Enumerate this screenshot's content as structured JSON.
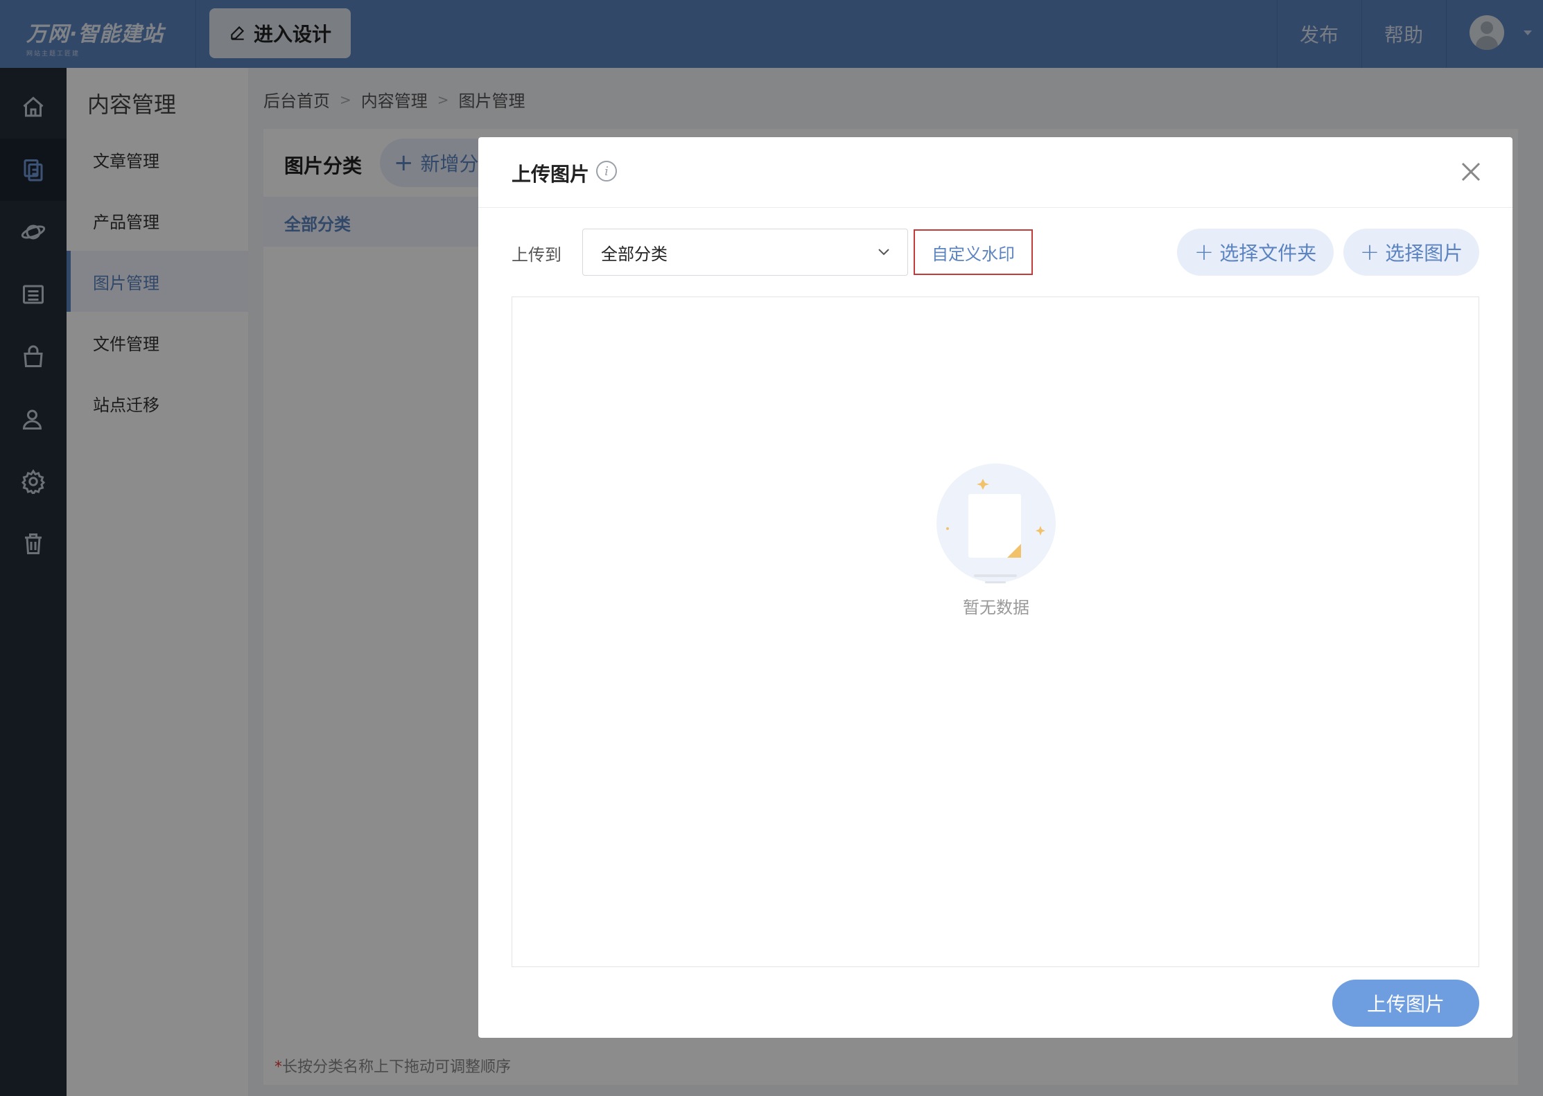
{
  "header": {
    "logo_main": "万网·智能建站",
    "logo_sub": "网站主题工匠建",
    "design_button": "进入设计",
    "publish": "发布",
    "help": "帮助"
  },
  "iconbar": {
    "items": [
      "home-icon",
      "content-icon",
      "planet-icon",
      "list-icon",
      "shop-icon",
      "user-icon",
      "gear-icon",
      "trash-icon"
    ],
    "active_index": 1
  },
  "subnav": {
    "title": "内容管理",
    "items": [
      {
        "label": "文章管理"
      },
      {
        "label": "产品管理"
      },
      {
        "label": "图片管理"
      },
      {
        "label": "文件管理"
      },
      {
        "label": "站点迁移"
      }
    ],
    "active_index": 2
  },
  "breadcrumb": {
    "items": [
      "后台首页",
      "内容管理",
      "图片管理"
    ],
    "separator": ">"
  },
  "main": {
    "category_title": "图片分类",
    "add_category": "新增分类",
    "all_categories": "全部分类",
    "hint_star": "*",
    "hint": "长按分类名称上下拖动可调整顺序"
  },
  "dialog": {
    "title": "上传图片",
    "info_glyph": "i",
    "upload_to_label": "上传到",
    "select_value": "全部分类",
    "watermark_button": "自定义水印",
    "select_folder_button": "选择文件夹",
    "select_image_button": "选择图片",
    "empty_text": "暂无数据",
    "submit_button": "上传图片"
  },
  "colors": {
    "topbar": "#5b83c0",
    "sidebar": "#252d3a",
    "accent": "#5b83c0",
    "watermark_border": "#c23a3a",
    "submit": "#6e9de0"
  }
}
